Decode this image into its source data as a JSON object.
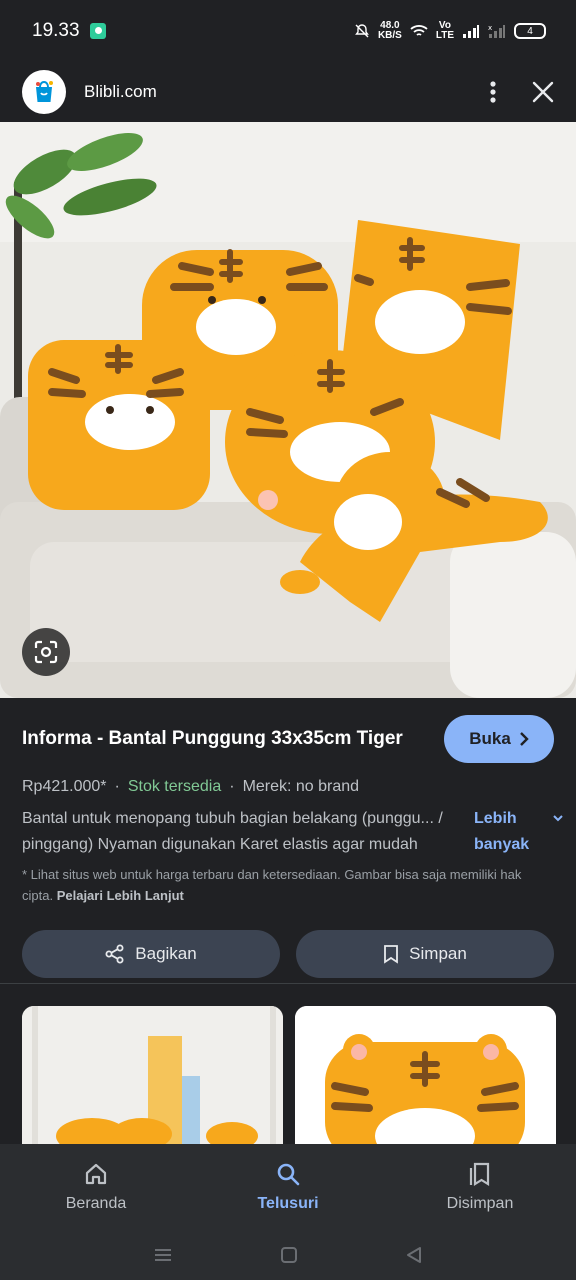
{
  "status_bar": {
    "time": "19.33",
    "net_speed_value": "48.0",
    "net_speed_unit": "KB/S",
    "volte_top": "Vo",
    "volte_bottom": "LTE",
    "battery": "4"
  },
  "header": {
    "site_name": "Blibli.com"
  },
  "product": {
    "title": "Informa - Bantal Punggung 33x35cm Tiger",
    "open_button": "Buka",
    "price": "Rp421.000*",
    "stock": "Stok tersedia",
    "brand": "Merek: no brand",
    "separator": "·",
    "description": "Bantal untuk menopang tubuh bagian belakang (punggu... / pinggang) Nyaman digunakan Karet elastis agar mudah",
    "more_label": "Lebih banyak",
    "disclaimer": "* Lihat situs web untuk harga terbaru dan ketersediaan. Gambar bisa saja memiliki hak cipta.",
    "learn_more": "Pelajari Lebih Lanjut"
  },
  "actions": {
    "share": "Bagikan",
    "save": "Simpan"
  },
  "bottom_nav": {
    "items": [
      {
        "label": "Beranda",
        "icon": "home-icon"
      },
      {
        "label": "Telusuri",
        "icon": "search-icon"
      },
      {
        "label": "Disimpan",
        "icon": "collections-icon"
      }
    ],
    "active": "Telusuri"
  },
  "colors": {
    "accent": "#8ab4f8",
    "stock_green": "#81c995",
    "background": "#202124"
  }
}
